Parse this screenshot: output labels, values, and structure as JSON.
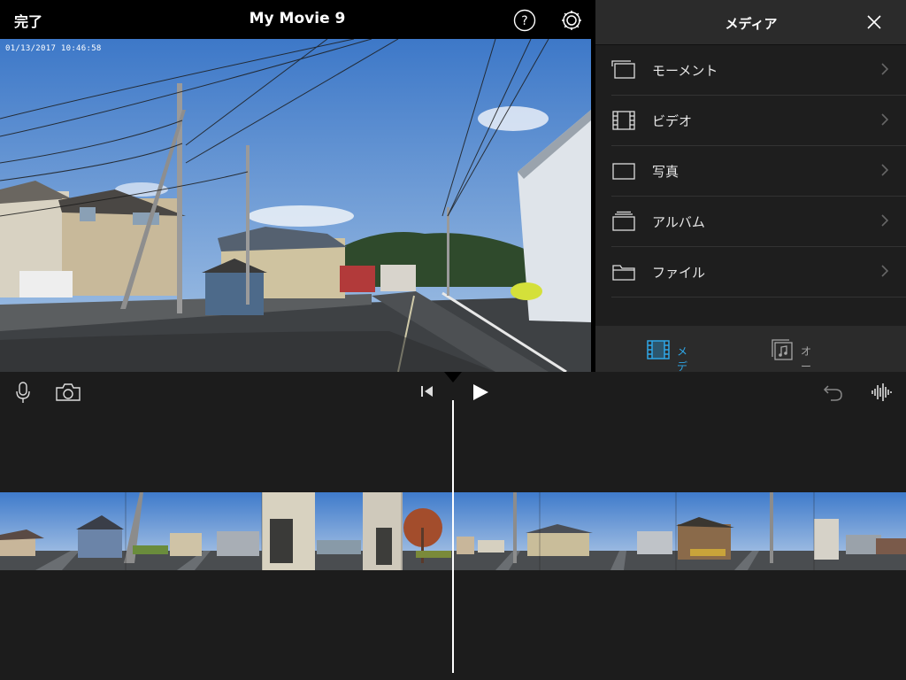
{
  "toolbar": {
    "done_label": "完了",
    "title": "My Movie 9",
    "help_icon": "help-icon",
    "settings_icon": "settings-gear-icon"
  },
  "viewer": {
    "timestamp": "01/13/2017   10:46:58"
  },
  "media_panel": {
    "title": "メディア",
    "items": [
      {
        "label": "モーメント",
        "icon": "moments-icon"
      },
      {
        "label": "ビデオ",
        "icon": "film-icon"
      },
      {
        "label": "写真",
        "icon": "photo-icon"
      },
      {
        "label": "アルバム",
        "icon": "album-icon"
      },
      {
        "label": "ファイル",
        "icon": "folder-icon"
      }
    ],
    "tabs": [
      {
        "label": "メディア",
        "icon": "film-icon",
        "selected": true
      },
      {
        "label": "オーディオ",
        "icon": "music-note-icon",
        "selected": false
      }
    ]
  },
  "timeline": {
    "tools_left": [
      "microphone-icon",
      "camera-icon"
    ],
    "tools_center": [
      "skip-to-start-icon",
      "play-icon"
    ],
    "tools_right": [
      "undo-icon",
      "audio-waveform-icon"
    ]
  },
  "colors": {
    "accent": "#2fa7e8",
    "panel_bg": "#1e1e1e",
    "timeline_bg": "#1c1c1c"
  }
}
